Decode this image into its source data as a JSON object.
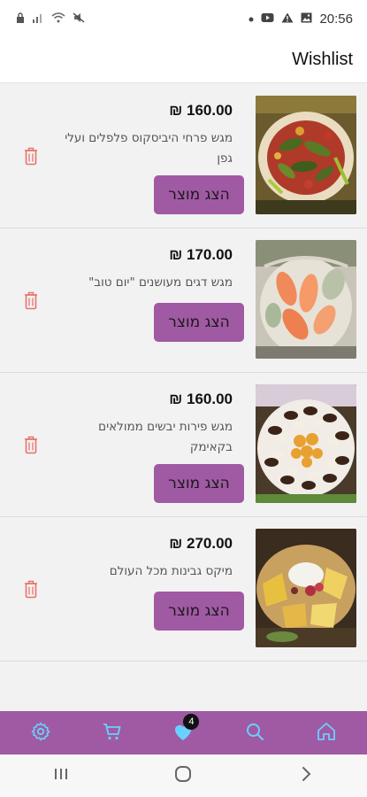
{
  "status_bar": {
    "time": "20:56",
    "left_icons": [
      "lock-icon",
      "signal-icon",
      "wifi-icon",
      "mute-icon"
    ],
    "right_icons": [
      "dot-icon",
      "youtube-icon",
      "warning-icon",
      "image-icon"
    ]
  },
  "header": {
    "title": "Wishlist"
  },
  "wishlist": {
    "button_label": "הצג מוצר",
    "items": [
      {
        "price": "160.00 ₪",
        "name": "מגש פרחי היביסקוס פלפלים ועלי גפן"
      },
      {
        "price": "170.00 ₪",
        "name": "מגש דגים מעושנים \"יום טוב\""
      },
      {
        "price": "160.00 ₪",
        "name": "מגש פירות יבשים ממולאים בקאימק"
      },
      {
        "price": "270.00 ₪",
        "name": "מיקס גבינות מכל העולם"
      }
    ]
  },
  "bottom_nav": {
    "items": [
      "settings-icon",
      "cart-icon",
      "heart-icon",
      "search-icon",
      "home-icon"
    ],
    "wishlist_badge": "4"
  },
  "colors": {
    "accent": "#a05aa3",
    "delete": "#e8736a",
    "background": "#f2f2f2"
  }
}
